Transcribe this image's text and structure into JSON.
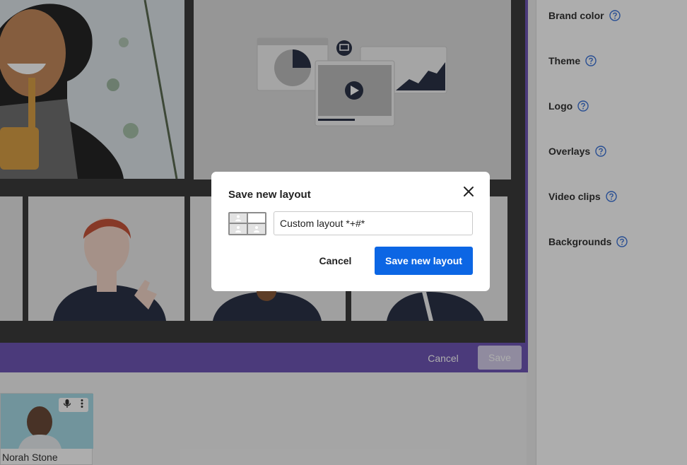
{
  "colors": {
    "accent": "#0c66e4",
    "stage_border": "#6f56b6",
    "stage_background": "#3c3c3c",
    "overlay": "rgba(0,0,0,0.32)"
  },
  "sidebar": {
    "items": [
      {
        "label": "Brand color",
        "icon": "help-icon"
      },
      {
        "label": "Theme",
        "icon": "help-icon"
      },
      {
        "label": "Logo",
        "icon": "help-icon"
      },
      {
        "label": "Overlays",
        "icon": "help-icon"
      },
      {
        "label": "Video clips",
        "icon": "help-icon"
      },
      {
        "label": "Backgrounds",
        "icon": "help-icon"
      }
    ]
  },
  "stage": {
    "footer": {
      "cancel_label": "Cancel",
      "save_label": "Save"
    }
  },
  "backstage": {
    "guest": {
      "name": "Norah Stone",
      "icons": [
        "microphone-icon",
        "more-vertical-icon"
      ]
    }
  },
  "modal": {
    "title": "Save new layout",
    "close_icon": "close-icon",
    "layout_name_value": "Custom layout *+#*",
    "cancel_label": "Cancel",
    "save_label": "Save new layout"
  }
}
